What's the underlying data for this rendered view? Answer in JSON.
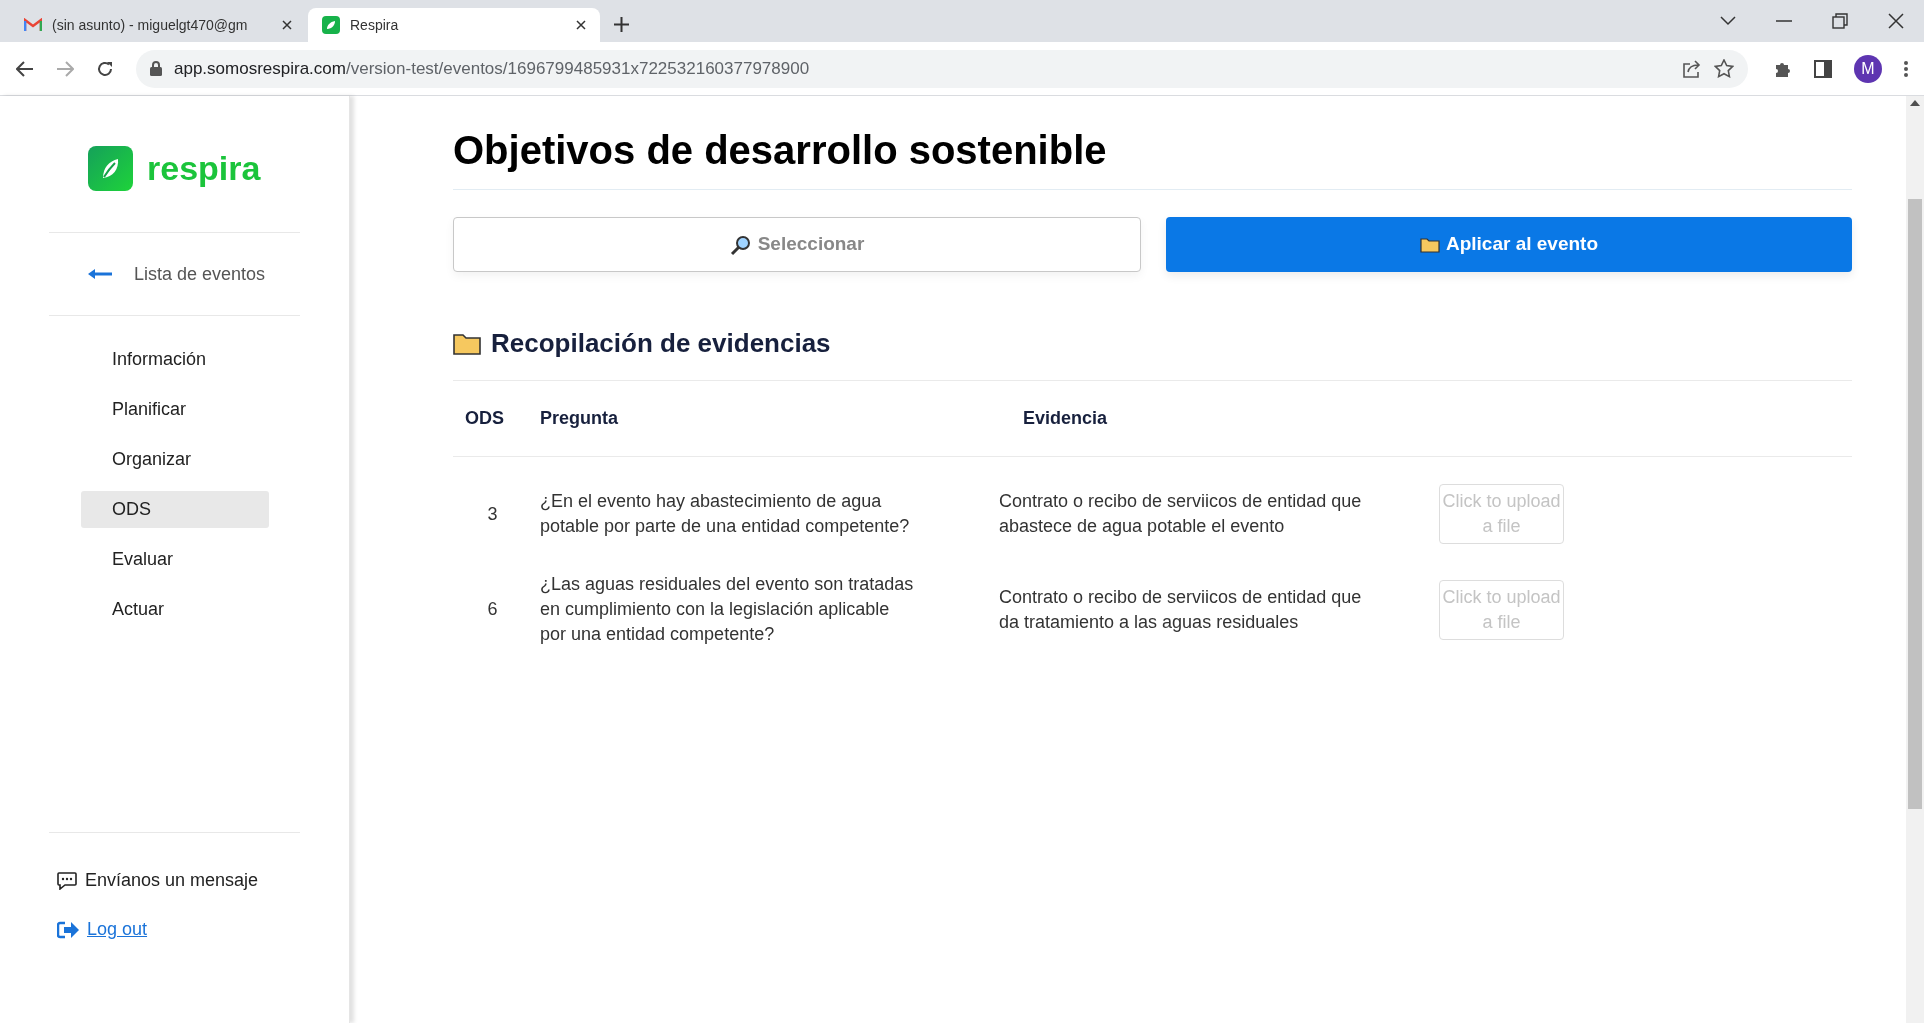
{
  "browser": {
    "tabs": [
      {
        "title": "(sin asunto) - miguelgt470@gm",
        "selected": false,
        "kind": "mail"
      },
      {
        "title": "Respira",
        "selected": true,
        "kind": "app"
      }
    ],
    "url_host": "app.somosrespira.com",
    "url_path": "/version-test/eventos/1696799485931x722532160377978900",
    "profile_initial": "M"
  },
  "sidebar": {
    "logo": "respira",
    "back_link": "Lista de eventos",
    "items": [
      {
        "label": "Información",
        "selected": false
      },
      {
        "label": "Planificar",
        "selected": false
      },
      {
        "label": "Organizar",
        "selected": false
      },
      {
        "label": "ODS",
        "selected": true
      },
      {
        "label": "Evaluar",
        "selected": false
      },
      {
        "label": "Actuar",
        "selected": false
      }
    ],
    "message_link": "Envíanos un mensaje",
    "logout_link": "Log out"
  },
  "page": {
    "title": "Objetivos de desarrollo sostenible",
    "select_button": "Seleccionar",
    "apply_button": "Aplicar al evento",
    "section_title": "Recopilación de evidencias",
    "table": {
      "columns": [
        "ODS",
        "Pregunta",
        "Evidencia"
      ],
      "rows": [
        {
          "ods": "3",
          "question": "¿En el evento hay abastecimiento de agua potable por parte de una entidad competente?",
          "evidence": "Contrato o recibo de serviicos de entidad que abastece de agua potable el evento",
          "upload": "Click to upload a file"
        },
        {
          "ods": "6",
          "question": "¿Las aguas residuales del evento son tratadas en cumplimiento con la legislación aplicable por una entidad competente?",
          "evidence": "Contrato o recibo de serviicos de entidad que da tratamiento a las aguas residuales",
          "upload": "Click to upload a file"
        }
      ]
    }
  }
}
